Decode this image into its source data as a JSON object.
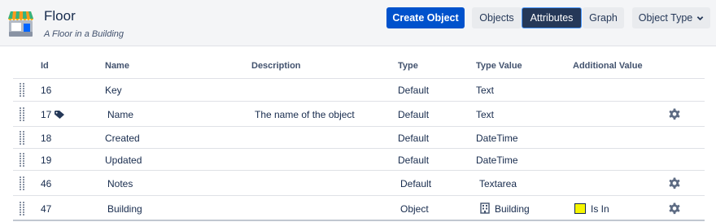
{
  "header": {
    "title": "Floor",
    "subtitle": "A Floor in a Building",
    "logo_icon": "store-icon"
  },
  "toolbar": {
    "create_label": "Create Object",
    "objects_label": "Objects",
    "attributes_label": "Attributes",
    "graph_label": "Graph",
    "object_type_label": "Object Type",
    "active_tab": "Attributes"
  },
  "table": {
    "columns": {
      "id": "Id",
      "name": "Name",
      "description": "Description",
      "type": "Type",
      "type_value": "Type Value",
      "additional": "Additional Value"
    },
    "rows": [
      {
        "id": "16",
        "name": "Key",
        "description": "",
        "type": "Default",
        "type_value": "Text",
        "additional": "",
        "has_gear": false,
        "has_tag": false
      },
      {
        "id": "17",
        "name": "Name",
        "description": "The name of the object",
        "type": "Default",
        "type_value": "Text",
        "additional": "",
        "has_gear": true,
        "has_tag": true
      },
      {
        "id": "18",
        "name": "Created",
        "description": "",
        "type": "Default",
        "type_value": "DateTime",
        "additional": "",
        "has_gear": false,
        "has_tag": false
      },
      {
        "id": "19",
        "name": "Updated",
        "description": "",
        "type": "Default",
        "type_value": "DateTime",
        "additional": "",
        "has_gear": false,
        "has_tag": false
      },
      {
        "id": "46",
        "name": "Notes",
        "description": "",
        "type": "Default",
        "type_value": "Textarea",
        "additional": "",
        "has_gear": true,
        "has_tag": false
      },
      {
        "id": "47",
        "name": "Building",
        "description": "",
        "type": "Object",
        "type_value": "Building",
        "additional": "Is In",
        "has_gear": true,
        "has_tag": false,
        "additional_color": "#f5f500"
      }
    ]
  },
  "colors": {
    "primary": "#0052cc",
    "active_tab": "#253858",
    "text": "#172b4d"
  }
}
